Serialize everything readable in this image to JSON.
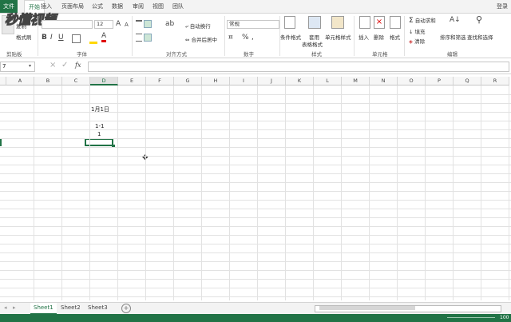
{
  "ribbon_tabs": {
    "file": "文件",
    "items": [
      "开始",
      "插入",
      "页面布局",
      "公式",
      "数据",
      "审阅",
      "视图",
      "团队"
    ],
    "active_index": 0,
    "login": "登录"
  },
  "watermark": "秒懂视频",
  "ribbon": {
    "clipboard": {
      "cut": "剪切",
      "copy": "复制",
      "format_painter": "格式刷",
      "group": "剪贴板"
    },
    "font": {
      "size": "12",
      "bold": "B",
      "italic": "I",
      "underline": "U",
      "grow": "A",
      "shrink": "A",
      "group": "字体"
    },
    "alignment": {
      "wrap": "自动换行",
      "merge": "合并后居中",
      "group": "对齐方式"
    },
    "number": {
      "format": "常规",
      "percent": "%",
      "comma": ",",
      "group": "数字"
    },
    "styles": {
      "conditional": "条件格式",
      "table": "套用",
      "table2": "表格格式",
      "cell": "单元格样式",
      "group": "样式"
    },
    "cells": {
      "insert": "插入",
      "delete": "删除",
      "format": "格式",
      "group": "单元格"
    },
    "editing": {
      "autosum": "自动求和",
      "fill": "填充",
      "clear": "清除",
      "sort": "排序和筛选",
      "find": "查找和选择",
      "group": "编辑"
    }
  },
  "formula_bar": {
    "namebox": "7",
    "fx": "fx",
    "cancel": "×",
    "enter": "✓",
    "dropdown": "▾"
  },
  "columns": [
    "A",
    "B",
    "C",
    "D",
    "E",
    "F",
    "G",
    "H",
    "I",
    "J",
    "K",
    "L",
    "M",
    "N",
    "O",
    "P",
    "Q",
    "R"
  ],
  "selected_column": "D",
  "cells": {
    "d_row2": "1月1日",
    "d_row4": "1-1",
    "d_row5": "1"
  },
  "sheets": [
    "Sheet1",
    "Sheet2",
    "Sheet3"
  ],
  "active_sheet": 0,
  "add_sheet": "+",
  "zoom_label": "100"
}
